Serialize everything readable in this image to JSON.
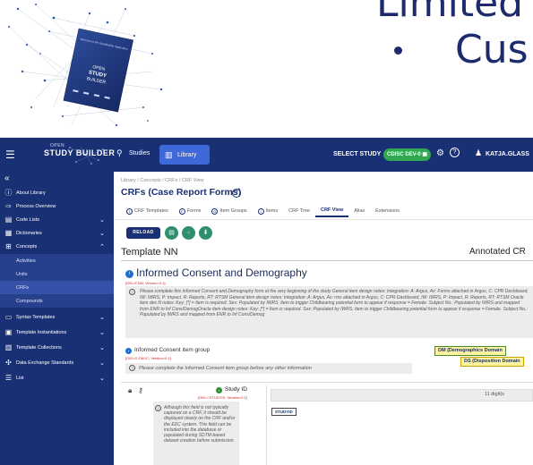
{
  "slide": {
    "title": "Limited",
    "bullet": "Cus"
  },
  "cover": {
    "small_text": "Welcome to the StudyBuilder Application",
    "brand_line1": "OPEN",
    "brand_line2": "STUDY",
    "brand_line3": "BUILDER"
  },
  "topbar": {
    "logo_small": "OPEN",
    "logo_main": "STUDY BUILDER",
    "studies_label": "Studies",
    "library_label": "Library",
    "select_study_label": "SELECT STUDY",
    "cdisc_badge": "CDISC DEV-0",
    "username": "KATJA.GLASS"
  },
  "sidebar": {
    "items": [
      {
        "label": "About Library",
        "icon": "info-icon",
        "chevron": ""
      },
      {
        "label": "Process Overview",
        "icon": "process-icon",
        "chevron": ""
      },
      {
        "label": "Code Lists",
        "icon": "codelist-icon",
        "chevron": "⌄"
      },
      {
        "label": "Dictionaries",
        "icon": "book-icon",
        "chevron": "⌄"
      },
      {
        "label": "Concepts",
        "icon": "concepts-icon",
        "chevron": "⌃"
      }
    ],
    "sub_items": [
      {
        "label": "Activities"
      },
      {
        "label": "Units"
      },
      {
        "label": "CRFs"
      },
      {
        "label": "Compounds"
      }
    ],
    "items_after": [
      {
        "label": "Syntax Templates",
        "icon": "template-icon",
        "chevron": "⌄"
      },
      {
        "label": "Template Instantiations",
        "icon": "instantiation-icon",
        "chevron": "⌄"
      },
      {
        "label": "Template Collections",
        "icon": "collection-icon",
        "chevron": "⌄"
      },
      {
        "label": "Data Exchange Standards",
        "icon": "exchange-icon",
        "chevron": "⌄"
      },
      {
        "label": "List",
        "icon": "list-icon",
        "chevron": "⌄"
      }
    ]
  },
  "main": {
    "breadcrumb": "Library / Concepts / CRFs / CRF View",
    "title": "CRFs (Case Report Forms)",
    "tabs": [
      {
        "label": "CRF Templates",
        "icon": "T"
      },
      {
        "label": "Forms",
        "icon": "F"
      },
      {
        "label": "Item Groups",
        "icon": "G"
      },
      {
        "label": "Items",
        "icon": "I"
      },
      {
        "label": "CRF Tree",
        "icon": ""
      },
      {
        "label": "CRF View",
        "icon": ""
      },
      {
        "label": "Alias",
        "icon": ""
      },
      {
        "label": "Extensions",
        "icon": ""
      }
    ],
    "reload_label": "RELOAD",
    "template_name": "Template NN",
    "annotated_label": "Annotated CR",
    "form": {
      "title": "Informed Consent and Demography",
      "oid": "[OID=F.DM, Version=0.1]",
      "note": "Please complete this Informed Consent and Demography form at the very beginning of the study General item design notes: Integration: A: Argus, Ax: Forms attached in Argus, C: CPR Dashboard, IW: IWRS, P: Impact, R: Reports, RT: RTSM General item design notes: Integration: A: Argus, Ax: rms attached in Argus, C: CPR Dashboard, IW: IWRS, P: Impact, R: Reports, RT: RTSM Oracle item des N notes: Key: [*] = Item is required. Sex: Populated by IWRS. Item to trigger Childbearing potential form to appear if response = Female. Subject No.: Populated by IWRS and mapped from ENR to Inf Cons/DemogOracle item design notes: Key: [*] = Item is required. Sex: Populated by IWRS. Item to trigger Childbearing potential form to appear if response = Female. Subject No.: Populated by IWRS and mapped from ENR to Inf Cons/Demog"
    },
    "item_group": {
      "title": "Informed Consent item group",
      "oid": "[OID=G.DM.IC, Version=0.1]",
      "note": "Please complete the Informed Consent item group before any other information",
      "badge_dm": "DM (Demographics Domain",
      "badge_ds": "DS (Disposition Domain"
    },
    "item": {
      "name": "Study ID",
      "oid": "[OID=I.STUDYID, Version=0.1]",
      "note": "Although this field is not typically captured on a CRF, it should be displayed clearly on the CRF and/or the EDC system. This field can be included into the database or populated during SDTM-based dataset creation before submission.",
      "input_hint": "11 digit(s",
      "sdtm_tag": "STUDYID"
    }
  }
}
